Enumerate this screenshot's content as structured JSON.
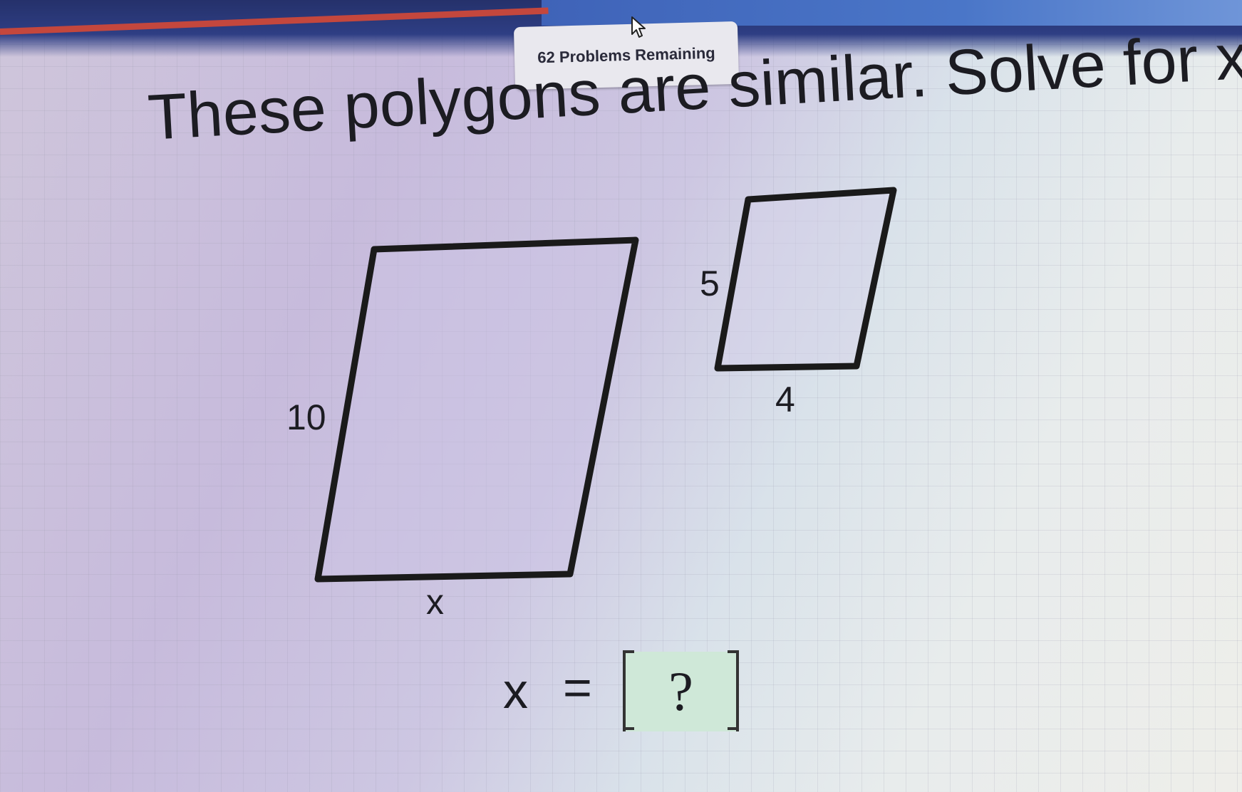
{
  "header": {
    "problems_remaining": "62 Problems Remaining"
  },
  "question": {
    "title": "These polygons are similar. Solve for x."
  },
  "figures": {
    "large": {
      "side_left": "10",
      "side_bottom": "x"
    },
    "small": {
      "side_left": "5",
      "side_bottom": "4"
    }
  },
  "answer": {
    "variable": "x",
    "equals": "=",
    "placeholder": "?"
  },
  "colors": {
    "progress_bar": "#c4473d",
    "header_blue": "#2e3e84",
    "answer_box": "#cfe8d8"
  }
}
